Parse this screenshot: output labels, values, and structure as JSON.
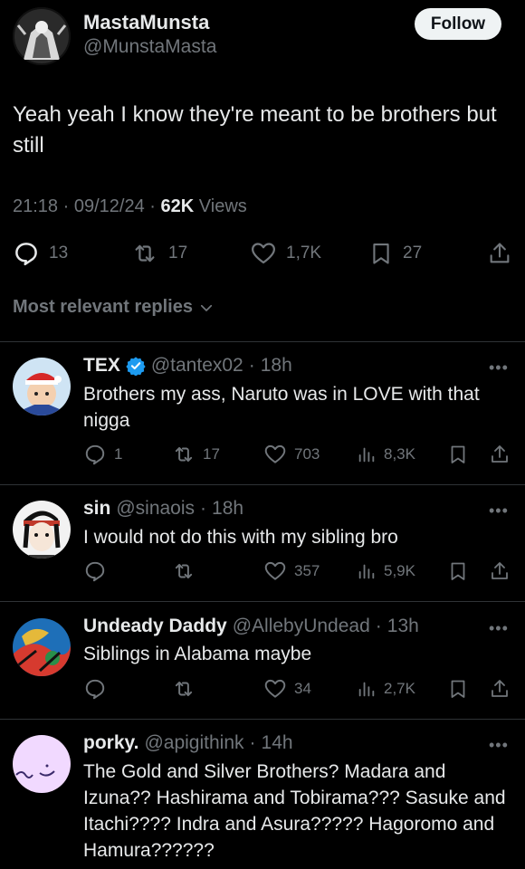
{
  "tweet": {
    "author_name": "MastaMunsta",
    "author_handle": "@MunstaMasta",
    "follow_label": "Follow",
    "text": "Yeah yeah I know they're meant to be brothers but still",
    "time": "21:18",
    "date": "09/12/24",
    "views_count": "62K",
    "views_label": "Views",
    "replies": "13",
    "reposts": "17",
    "likes": "1,7K",
    "bookmarks": "27"
  },
  "sort_label": "Most relevant replies",
  "replies": [
    {
      "name": "TEX",
      "verified": true,
      "handle": "@tantex02",
      "time": "18h",
      "text": "Brothers my ass, Naruto was in LOVE with that nigga",
      "replies": "1",
      "reposts": "17",
      "likes": "703",
      "views": "8,3K"
    },
    {
      "name": "sin",
      "verified": false,
      "handle": "@sinaois",
      "time": "18h",
      "text": "I would not do this with my sibling bro",
      "replies": "",
      "reposts": "",
      "likes": "357",
      "views": "5,9K"
    },
    {
      "name": "Undeady Daddy",
      "verified": false,
      "handle": "@AllebyUndead",
      "time": "13h",
      "text": "Siblings in Alabama maybe",
      "replies": "",
      "reposts": "",
      "likes": "34",
      "views": "2,7K"
    },
    {
      "name": "porky.",
      "verified": false,
      "handle": "@apigithink",
      "time": "14h",
      "text": "The Gold and Silver Brothers? Madara and Izuna?? Hashirama and Tobirama??? Sasuke and Itachi???? Indra and Asura????? Hagoromo and Hamura??????"
    }
  ],
  "colors": {
    "background": "#000000",
    "text": "#e7e9ea",
    "muted": "#71767b",
    "verified": "#1d9bf0",
    "divider": "#2f3336"
  }
}
